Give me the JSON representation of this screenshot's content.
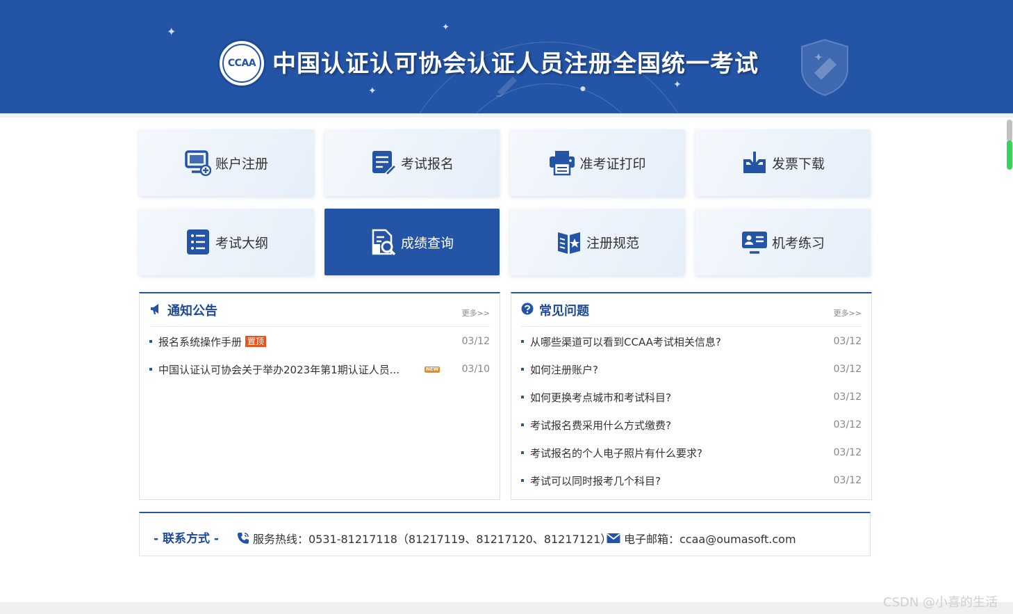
{
  "header": {
    "logo_text": "CCAA",
    "title": "中国认证认可协会认证人员注册全国统一考试"
  },
  "tiles": [
    {
      "label": "账户注册",
      "icon": "monitor-plus-icon"
    },
    {
      "label": "考试报名",
      "icon": "form-pen-icon"
    },
    {
      "label": "准考证打印",
      "icon": "printer-icon"
    },
    {
      "label": "发票下载",
      "icon": "download-tray-icon"
    },
    {
      "label": "考试大纲",
      "icon": "list-icon"
    },
    {
      "label": "成绩查询",
      "icon": "doc-search-icon",
      "active": true
    },
    {
      "label": "注册规范",
      "icon": "book-star-icon"
    },
    {
      "label": "机考练习",
      "icon": "id-card-icon"
    }
  ],
  "notices": {
    "title": "通知公告",
    "more": "更多>>",
    "items": [
      {
        "text": "报名系统操作手册",
        "tag": "置顶",
        "date": "03/12"
      },
      {
        "text": "中国认证认可协会关于举办2023年第1期认证人员...",
        "tag": "NEW",
        "date": "03/10"
      }
    ]
  },
  "faq": {
    "title": "常见问题",
    "more": "更多>>",
    "items": [
      {
        "text": "从哪些渠道可以看到CCAA考试相关信息?",
        "date": "03/12"
      },
      {
        "text": "如何注册账户?",
        "date": "03/12"
      },
      {
        "text": "如何更换考点城市和考试科目?",
        "date": "03/12"
      },
      {
        "text": "考试报名费采用什么方式缴费?",
        "date": "03/12"
      },
      {
        "text": "考试报名的个人电子照片有什么要求?",
        "date": "03/12"
      },
      {
        "text": "考试可以同时报考几个科目?",
        "date": "03/12"
      }
    ]
  },
  "contact": {
    "title": "- 联系方式 -",
    "hotline": "服务热线：0531-81217118（81217119、81217120、81217121）",
    "email": "电子邮箱：ccaa@oumasoft.com"
  },
  "watermark": "CSDN @小喜的生活",
  "colors": {
    "primary": "#2454a6",
    "dark": "#1d4a96",
    "tag_top": "#e8541f",
    "tag_new": "#ef8a1a"
  }
}
